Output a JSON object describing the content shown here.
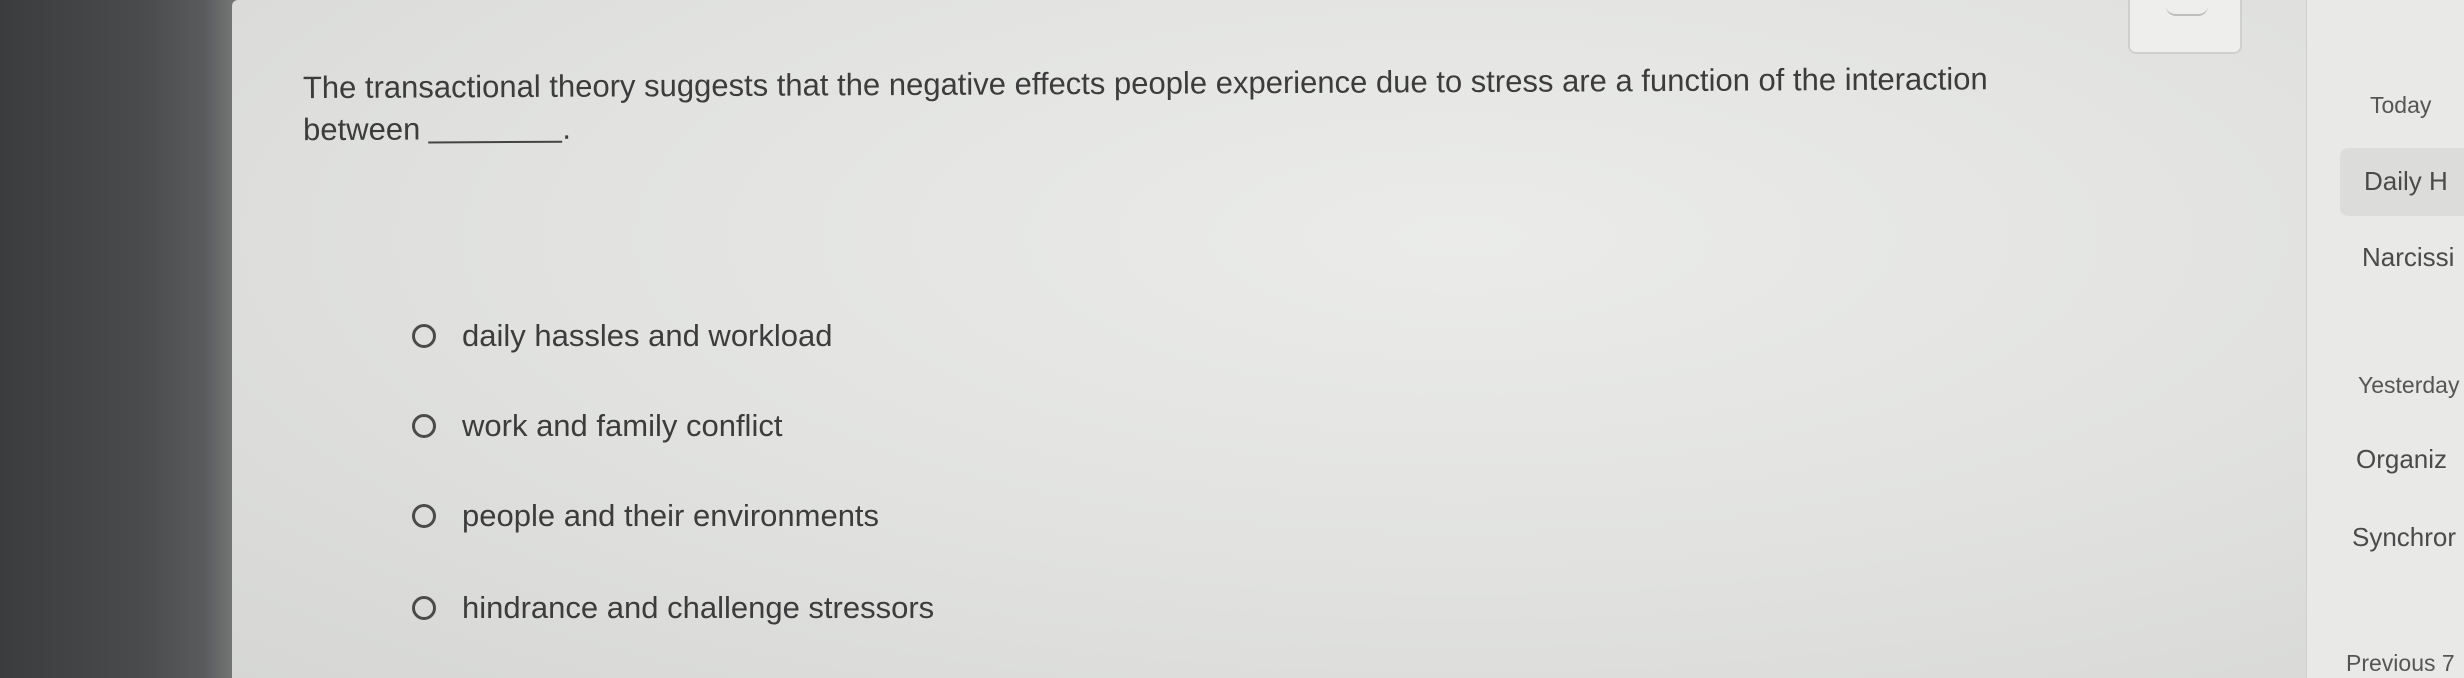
{
  "question": {
    "line1": "The transactional theory suggests that the negative effects people experience due to stress are a function of the interaction",
    "line2": "between",
    "end_punct": "."
  },
  "options": [
    {
      "label": "daily hassles and workload",
      "selected": false
    },
    {
      "label": "work and family conflict",
      "selected": false
    },
    {
      "label": "people and their environments",
      "selected": false
    },
    {
      "label": "hindrance and challenge stressors",
      "selected": false
    }
  ],
  "sidebar": {
    "today_heading": "Today",
    "today_items": [
      "Daily H",
      "Narcissi"
    ],
    "yesterday_heading": "Yesterday",
    "yesterday_items": [
      "Organiz",
      "Synchror"
    ],
    "previous_heading": "Previous 7"
  },
  "icons": {
    "top_button": "speaker-icon"
  }
}
